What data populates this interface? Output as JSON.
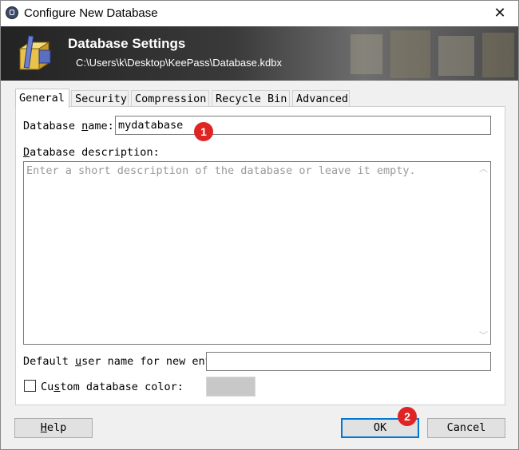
{
  "window": {
    "title": "Configure New Database",
    "close_glyph": "✕"
  },
  "banner": {
    "title": "Database Settings",
    "path": "C:\\Users\\k\\Desktop\\KeePass\\Database.kdbx"
  },
  "tabs": [
    {
      "label": "General",
      "active": true
    },
    {
      "label": "Security",
      "active": false
    },
    {
      "label": "Compression",
      "active": false
    },
    {
      "label": "Recycle Bin",
      "active": false
    },
    {
      "label": "Advanced",
      "active": false
    }
  ],
  "general": {
    "name_label_pre": "Database ",
    "name_label_key": "n",
    "name_label_post": "ame:",
    "name_value": "mydatabase",
    "description_label_key": "D",
    "description_label_post": "atabase description:",
    "description_placeholder": "Enter a short description of the database or leave it empty.",
    "default_user_label_pre": "Default ",
    "default_user_label_key": "u",
    "default_user_label_post": "ser name for new ent",
    "default_user_value": "",
    "custom_color_label_pre": "Cu",
    "custom_color_label_key": "s",
    "custom_color_label_post": "tom database color:",
    "custom_color_checked": false,
    "custom_color_swatch": "#c8c8c8"
  },
  "buttons": {
    "help_key": "H",
    "help_post": "elp",
    "ok": "OK",
    "cancel": "Cancel"
  },
  "markers": [
    "1",
    "2"
  ],
  "colors": {
    "accent": "#0078d7",
    "marker": "#e02424"
  }
}
